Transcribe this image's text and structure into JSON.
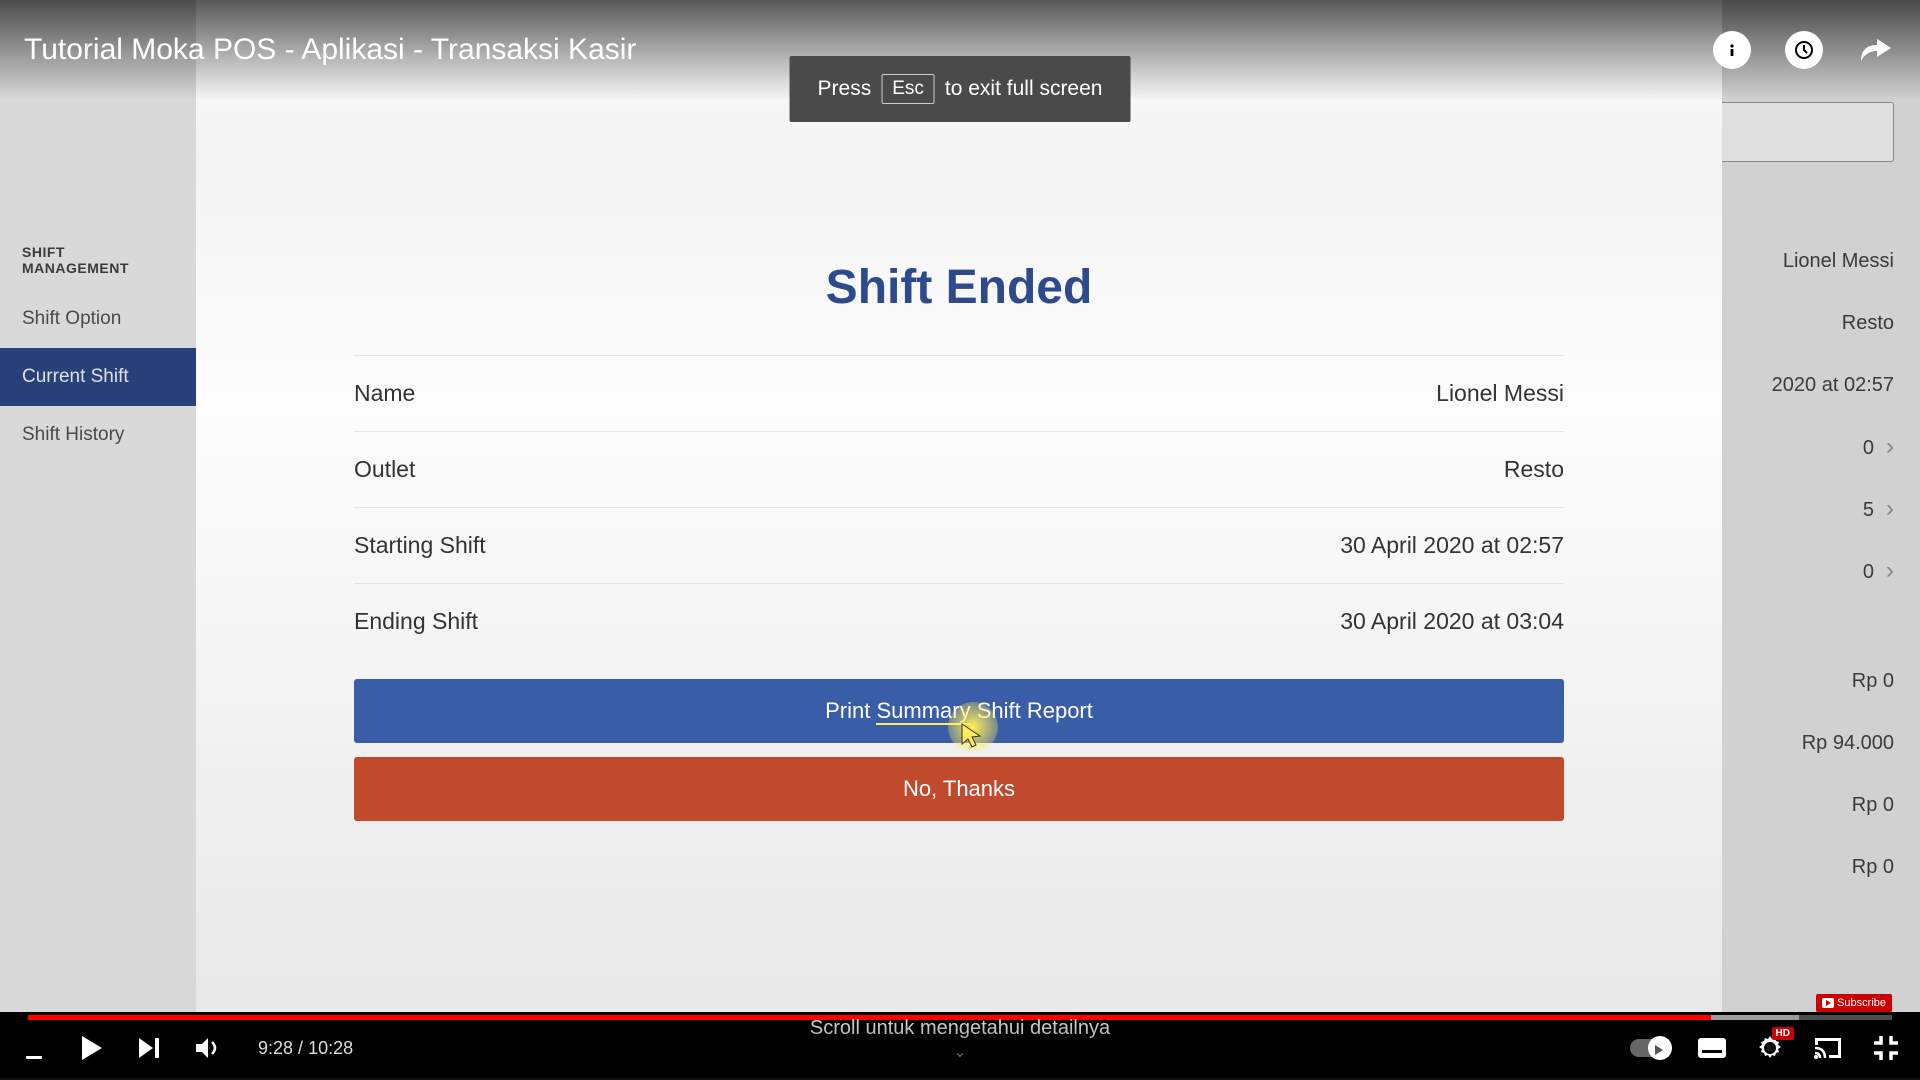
{
  "header": {
    "title": "Tutorial Moka POS - Aplikasi - Transaksi Kasir"
  },
  "toast": {
    "press": "Press",
    "key": "Esc",
    "rest": "to exit full screen"
  },
  "sidebar": {
    "header": "SHIFT MANAGEMENT",
    "items": [
      "Shift Option",
      "Current Shift",
      "Shift History"
    ]
  },
  "right": {
    "name": "Lionel Messi",
    "outlet": "Resto",
    "time": "2020 at 02:57",
    "v0": "0",
    "v5": "5",
    "v0b": "0",
    "rp0a": "Rp 0",
    "rp94": "Rp 94.000",
    "rp0b": "Rp 0",
    "rp0c": "Rp 0"
  },
  "modal": {
    "title": "Shift Ended",
    "name_label": "Name",
    "name_value": "Lionel Messi",
    "outlet_label": "Outlet",
    "outlet_value": "Resto",
    "start_label": "Starting Shift",
    "start_value": "30 April 2020 at 02:57",
    "end_label": "Ending Shift",
    "end_value": "30 April 2020 at 03:04",
    "print_pre": "Print ",
    "print_mid": "Summary",
    "print_post": " Shift Report",
    "no_thanks": "No, Thanks"
  },
  "subscribe": "Subscribe",
  "playback": {
    "current": "9:28",
    "sep": " / ",
    "total": "10:28"
  },
  "caption": "Scroll untuk mengetahui detailnya",
  "hd": "HD"
}
